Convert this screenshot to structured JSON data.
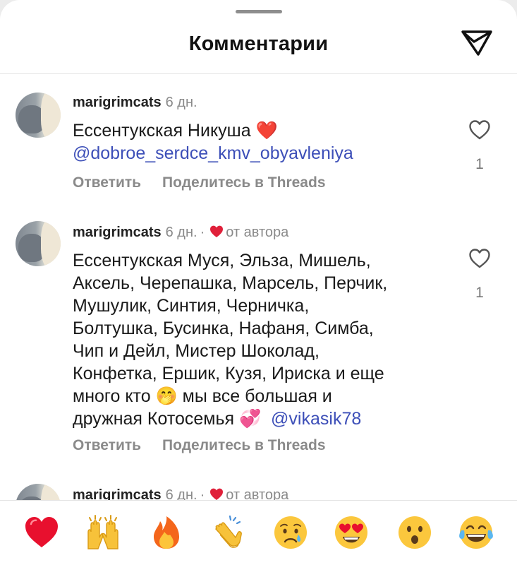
{
  "header": {
    "title": "Комментарии",
    "send_icon": "send-paper-plane-icon"
  },
  "comments": [
    {
      "username": "marigrimcats",
      "time": "6 дн.",
      "text_lines": [
        "Ессентукская Никуша ❤️"
      ],
      "mention": "@dobroe_serdce_kmv_obyavleniya",
      "reply_label": "Ответить",
      "share_label": "Поделитесь в Threads",
      "likes": "1"
    },
    {
      "username": "marigrimcats",
      "time": "6 дн.",
      "separator": "·",
      "author_label": "от автора",
      "text_lines": [
        "Ессентукская Муся, Эльза, Мишель,",
        "Аксель, Черепашка, Марсель, Перчик,",
        "Мушулик, Синтия, Черничка,",
        "Болтушка, Бусинка, Нафаня, Симба,",
        "Чип и Дейл, Мистер Шоколад,",
        "Конфетка, Ершик, Кузя, Ириска и еще",
        "много кто 🤭 мы все большая и",
        "дружная Котосемья 💞"
      ],
      "mention": "@vikasik78",
      "reply_label": "Ответить",
      "share_label": "Поделитесь в Threads",
      "likes": "1"
    },
    {
      "username": "marigrimcats",
      "time": "6 дн.",
      "separator": "·",
      "author_label": "от автора"
    }
  ],
  "reactions": [
    {
      "name": "red-heart",
      "emoji": "❤️"
    },
    {
      "name": "raising-hands",
      "emoji": "🙌"
    },
    {
      "name": "fire",
      "emoji": "🔥"
    },
    {
      "name": "clapping-hands",
      "emoji": "👏"
    },
    {
      "name": "crying-face",
      "emoji": "😢"
    },
    {
      "name": "heart-eyes",
      "emoji": "😍"
    },
    {
      "name": "surprised-face",
      "emoji": "😮"
    },
    {
      "name": "tears-of-joy",
      "emoji": "😂"
    }
  ],
  "colors": {
    "mention": "#3d4fb8",
    "secondary_text": "#8a8a8a",
    "heart_red": "#e0203a"
  }
}
